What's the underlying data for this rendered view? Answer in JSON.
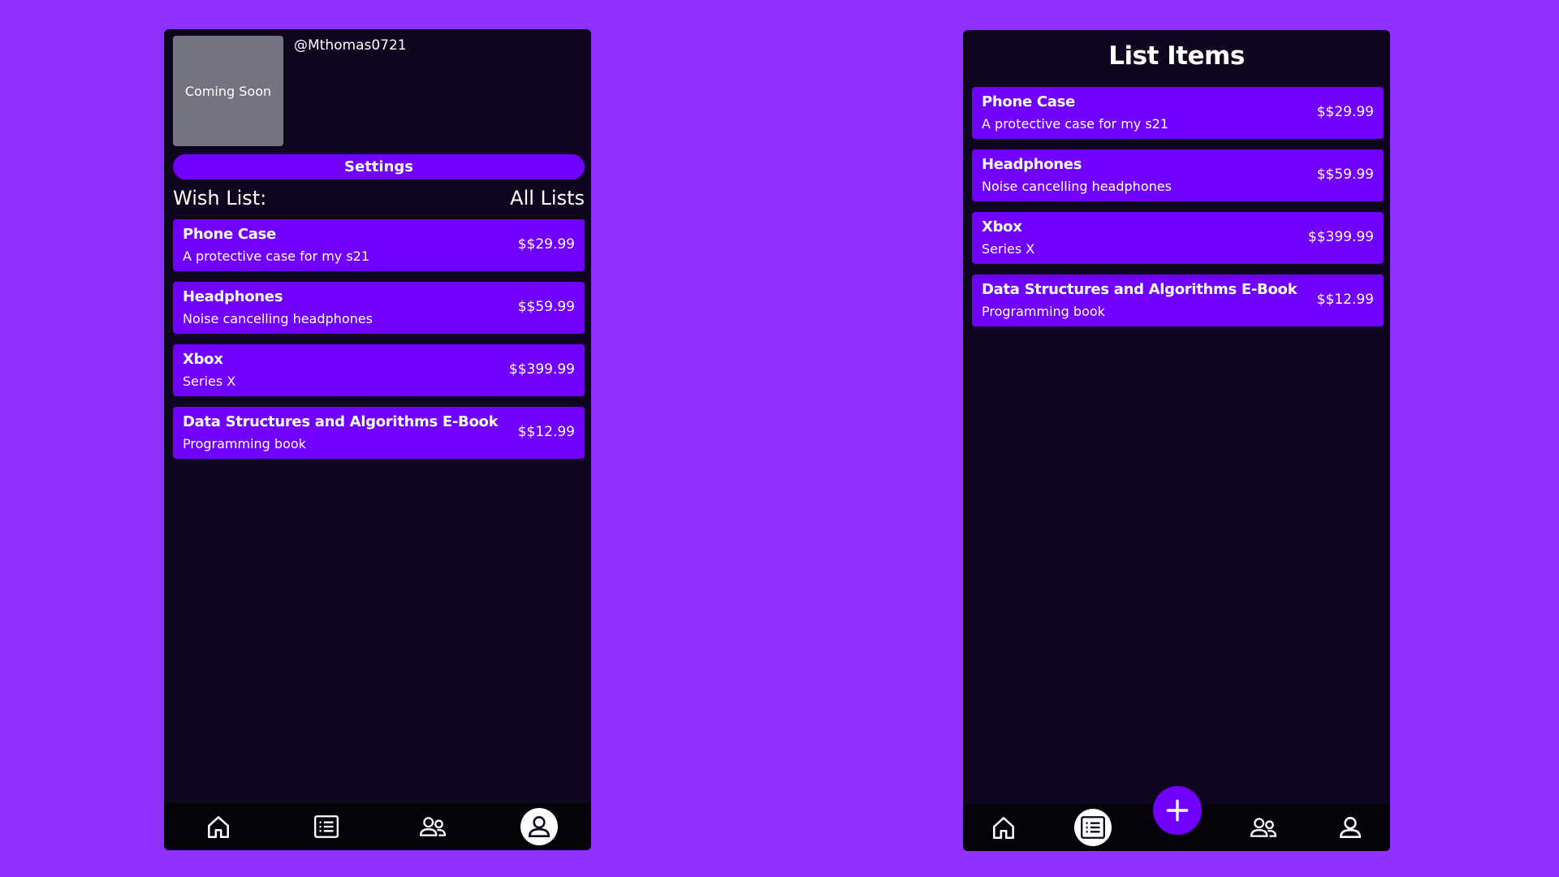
{
  "profile_screen": {
    "avatar_text": "Coming Soon",
    "username": "@Mthomas0721",
    "settings_label": "Settings",
    "list_label": "Wish List:",
    "all_lists_label": "All Lists",
    "items": [
      {
        "name": "Phone Case",
        "description": "A protective case for my s21",
        "price": "$$29.99"
      },
      {
        "name": "Headphones",
        "description": "Noise cancelling headphones",
        "price": "$$59.99"
      },
      {
        "name": "Xbox",
        "description": "Series X",
        "price": "$$399.99"
      },
      {
        "name": "Data Structures and Algorithms E-Book",
        "description": "Programming book",
        "price": "$$12.99"
      }
    ],
    "nav": [
      "home-icon",
      "list-icon",
      "friends-icon",
      "profile-icon"
    ],
    "active_nav": "profile-icon"
  },
  "list_screen": {
    "title": "List Items",
    "items": [
      {
        "name": "Phone Case",
        "description": "A protective case for my s21",
        "price": "$$29.99"
      },
      {
        "name": "Headphones",
        "description": "Noise cancelling headphones",
        "price": "$$59.99"
      },
      {
        "name": "Xbox",
        "description": "Series X",
        "price": "$$399.99"
      },
      {
        "name": "Data Structures and Algorithms E-Book",
        "description": "Programming book",
        "price": "$$12.99"
      }
    ],
    "nav": [
      "home-icon",
      "list-icon",
      "add-icon",
      "friends-icon",
      "profile-icon"
    ],
    "active_nav": "list-icon"
  },
  "colors": {
    "background": "#8e30ff",
    "panel": "#10051e",
    "accent": "#7000ff",
    "navbar": "#050209",
    "placeholder": "#747480"
  }
}
